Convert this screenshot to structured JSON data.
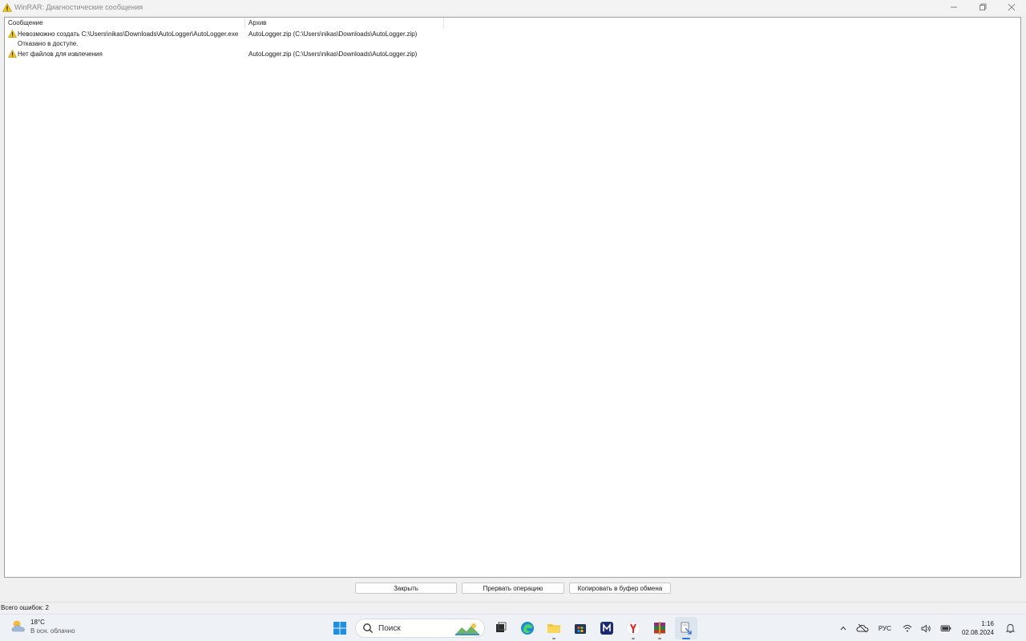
{
  "window": {
    "title": "WinRAR: Диагностические сообщения",
    "icon": "warning-icon"
  },
  "list": {
    "columns": [
      "Сообщение",
      "Архив"
    ],
    "rows": [
      {
        "icon": "warning-icon",
        "message": "Невозможно создать C:\\Users\\nikas\\Downloads\\AutoLogger\\AutoLogger.exe",
        "archive": "AutoLogger.zip (C:\\Users\\nikas\\Downloads\\AutoLogger.zip)"
      },
      {
        "icon": "",
        "message": "Отказано в доступе.",
        "archive": ""
      },
      {
        "icon": "warning-icon",
        "message": "Нет файлов для извлечения",
        "archive": "AutoLogger.zip (C:\\Users\\nikas\\Downloads\\AutoLogger.zip)"
      }
    ]
  },
  "buttons": {
    "close": "Закрыть",
    "abort": "Прервать операцию",
    "copy": "Копировать в буфер обмена"
  },
  "status": {
    "text": "Всего ошибок: 2"
  },
  "taskbar": {
    "weather": {
      "temp": "18°C",
      "condition": "В осн. облачно"
    },
    "search_placeholder": "Поиск",
    "language": "РУС",
    "time": "1:16",
    "date": "02.08.2024",
    "accent": "#2f6fd6"
  }
}
